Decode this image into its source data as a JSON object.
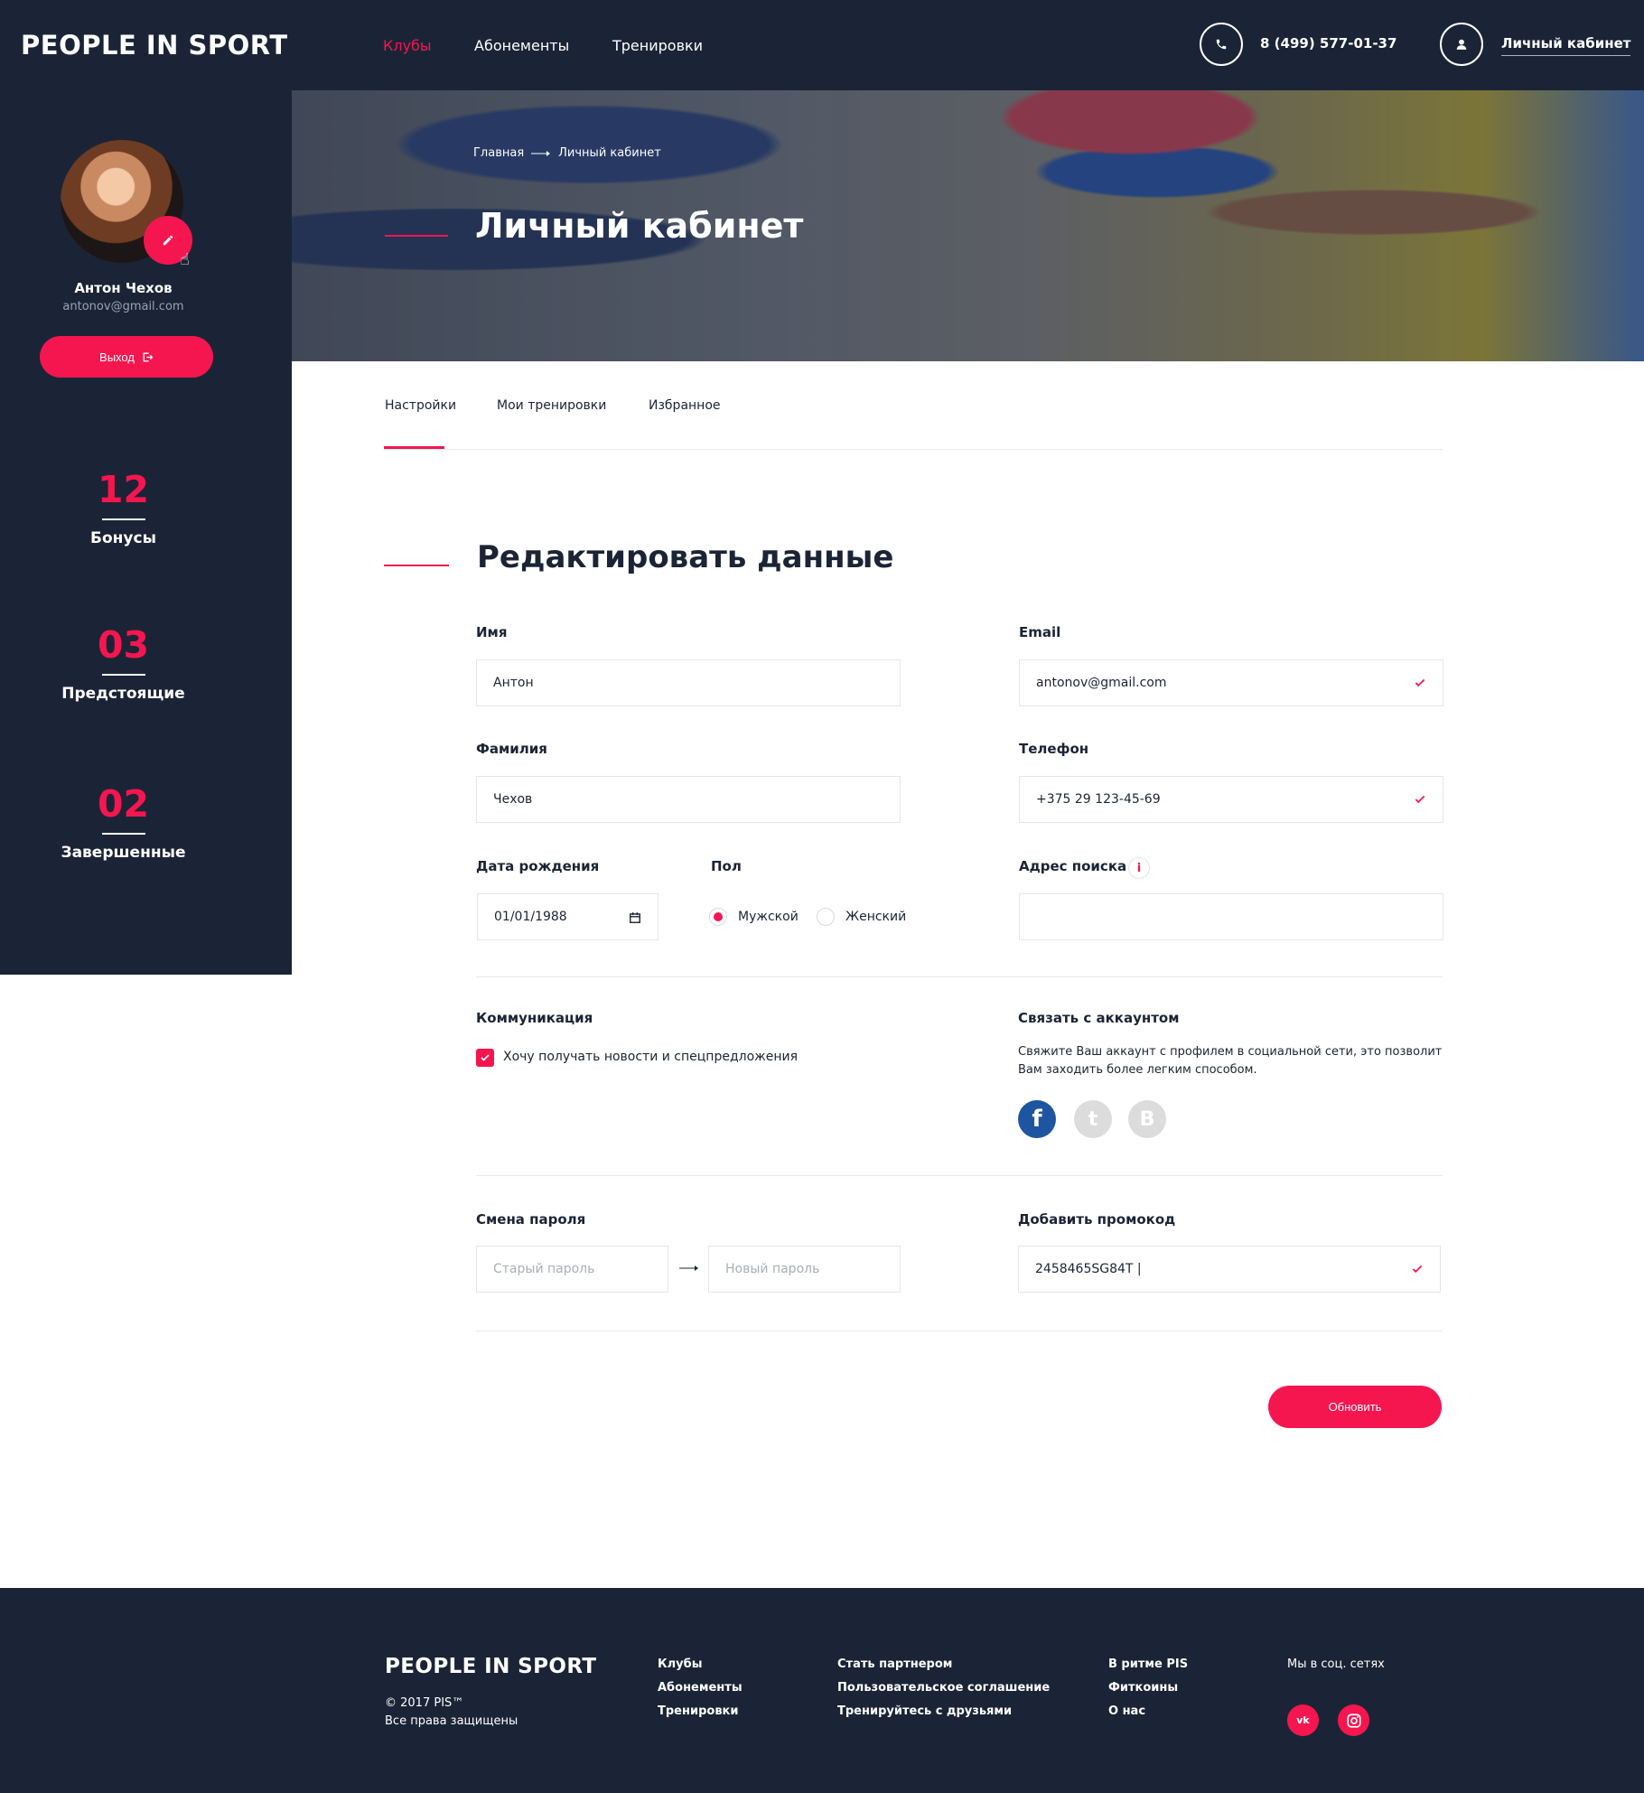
{
  "header": {
    "logo": "PEOPLE IN SPORT",
    "nav": [
      "Клубы",
      "Абонементы",
      "Тренировки"
    ],
    "phone": "8 (499) 577-01-37",
    "account": "Личный кабинет"
  },
  "sidebar": {
    "name": "Антон Чехов",
    "email": "antonov@gmail.com",
    "logout": "Выход",
    "stats": [
      {
        "value": "12",
        "label": "Бонусы"
      },
      {
        "value": "03",
        "label": "Предстоящие"
      },
      {
        "value": "02",
        "label": "Завершенные"
      }
    ]
  },
  "hero": {
    "breadcrumb": [
      "Главная",
      "Личный кабинет"
    ],
    "title": "Личный кабинет"
  },
  "tabs": [
    "Настройки",
    "Мои тренировки",
    "Избранное"
  ],
  "form": {
    "title": "Редактировать данные",
    "first_name": {
      "label": "Имя",
      "value": "Антон"
    },
    "email": {
      "label": "Email",
      "value": "antonov@gmail.com"
    },
    "last_name": {
      "label": "Фамилия",
      "value": "Чехов"
    },
    "phone": {
      "label": "Телефон",
      "value": "+375 29 123-45-69"
    },
    "birth": {
      "label": "Дата рождения",
      "value": "01/01/1988"
    },
    "gender": {
      "label": "Пол",
      "options": [
        "Мужской",
        "Женский"
      ],
      "selected": "Мужской"
    },
    "address": {
      "label": "Адрес поиска",
      "info": "i",
      "value": ""
    },
    "communication": {
      "label": "Коммуникация",
      "checkbox": "Хочу получать новости и спецпредложения",
      "checked": true
    },
    "link_account": {
      "label": "Связать с аккаунтом",
      "description": "Свяжите Ваш аккаунт с профилем в социальной  сети, это позволит Вам заходить более легким способом.",
      "networks": [
        {
          "icon": "facebook-icon",
          "glyph": "f",
          "color": "#1e55a0"
        },
        {
          "icon": "twitter-icon",
          "glyph": "t",
          "color": "#dcdcdc"
        },
        {
          "icon": "vk-icon",
          "glyph": "B",
          "color": "#dcdcdc"
        }
      ]
    },
    "password": {
      "label": "Смена пароля",
      "old_placeholder": "Старый пароль",
      "new_placeholder": "Новый пароль"
    },
    "promo": {
      "label": "Добавить промокод",
      "value": "2458465SG84T |"
    },
    "submit": "Обновить"
  },
  "footer": {
    "logo": "PEOPLE IN SPORT",
    "copyright": "© 2017 PIS™",
    "rights": "Все права защищены",
    "col1": [
      "Клубы",
      "Абонементы",
      "Тренировки"
    ],
    "col2": [
      "Стать партнером",
      "Пользовательское соглашение",
      "Тренируйтесь с друзьями"
    ],
    "col3": [
      "В ритме PIS",
      "Фиткоины",
      "О нас"
    ],
    "social_title": "Мы в соц. сетях",
    "social": [
      "vk-icon",
      "instagram-icon"
    ]
  },
  "colors": {
    "accent": "#f5164f",
    "dark": "#1b2436",
    "facebook": "#1e55a0"
  }
}
